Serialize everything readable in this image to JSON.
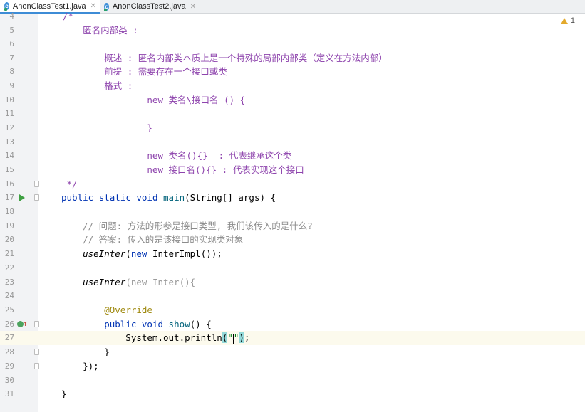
{
  "tabs": [
    {
      "label": "AnonClassTest1.java",
      "icon": "class-icon",
      "active": true
    },
    {
      "label": "AnonClassTest2.java",
      "icon": "class-icon",
      "active": false
    }
  ],
  "warnings": {
    "count": "1"
  },
  "colors": {
    "keyword": "#0033b3",
    "comment": "#8c8c8c",
    "doc": "#8e44ad",
    "annotation": "#9e880d",
    "string": "#067d17",
    "method": "#00627a"
  },
  "lines": [
    {
      "n": "4",
      "t0": "/*"
    },
    {
      "n": "5",
      "t0": "    匿名内部类 :"
    },
    {
      "n": "6",
      "t0": ""
    },
    {
      "n": "7",
      "t0": "        概述 : 匿名内部类本质上是一个特殊的局部内部类（定义在方法内部）"
    },
    {
      "n": "8",
      "t0": "        前提 : 需要存在一个接口或类"
    },
    {
      "n": "9",
      "t0": "        格式 :"
    },
    {
      "n": "10",
      "t0": "                new 类名\\接口名 () {"
    },
    {
      "n": "11",
      "t0": ""
    },
    {
      "n": "12",
      "t0": "                }"
    },
    {
      "n": "13",
      "t0": ""
    },
    {
      "n": "14",
      "t0": "                new 类名(){}  : 代表继承这个类"
    },
    {
      "n": "15",
      "t0": "                new 接口名(){} : 代表实现这个接口"
    },
    {
      "n": "16",
      "t0": " */"
    },
    {
      "n": "17",
      "t0": "public",
      "t1": " ",
      "t2": "static",
      "t3": " ",
      "t4": "void",
      "t5": " ",
      "t6": "main",
      "t7": "(String[] args) {"
    },
    {
      "n": "18",
      "t0": ""
    },
    {
      "n": "19",
      "t0": "    // 问题: 方法的形参是接口类型, 我们该传入的是什么?"
    },
    {
      "n": "20",
      "t0": "    // 答案: 传入的是该接口的实现类对象"
    },
    {
      "n": "21",
      "t0": "    ",
      "t1": "useInter",
      "t2": "(",
      "t3": "new",
      "t4": " InterImpl());"
    },
    {
      "n": "22",
      "t0": ""
    },
    {
      "n": "23",
      "t0": "    ",
      "t1": "useInter",
      "t2": "(new Inter(){"
    },
    {
      "n": "24",
      "t0": ""
    },
    {
      "n": "25",
      "t0": "        ",
      "t1": "@Override"
    },
    {
      "n": "26",
      "t0": "        ",
      "t1": "public",
      "t2": " ",
      "t3": "void",
      "t4": " ",
      "t5": "show",
      "t6": "() {"
    },
    {
      "n": "27",
      "t0": "            System.out.println",
      "t1": "(",
      "t2": "\"",
      "t3": "\"",
      "t4": ")",
      "t5": ";"
    },
    {
      "n": "28",
      "t0": "        }"
    },
    {
      "n": "29",
      "t0": "    });"
    },
    {
      "n": "30",
      "t0": ""
    },
    {
      "n": "31",
      "t0": "}"
    }
  ]
}
